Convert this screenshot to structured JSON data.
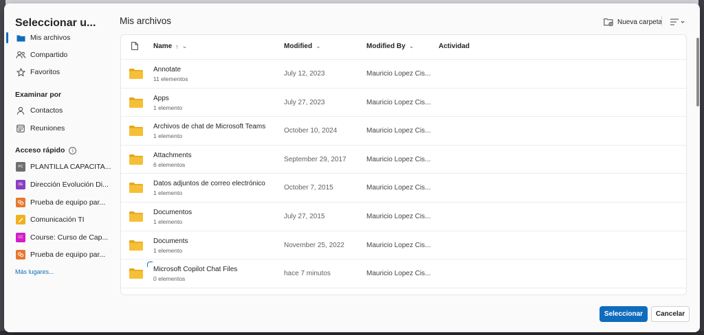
{
  "dialog": {
    "title": "Seleccionar u...",
    "main_title": "Mis archivos"
  },
  "sidebar": {
    "nav": [
      {
        "label": "Mis archivos",
        "icon": "folder-icon",
        "active": true
      },
      {
        "label": "Compartido",
        "icon": "people-icon",
        "active": false
      },
      {
        "label": "Favoritos",
        "icon": "star-icon",
        "active": false
      }
    ],
    "browse_heading": "Examinar por",
    "browse": [
      {
        "label": "Contactos",
        "icon": "person-icon"
      },
      {
        "label": "Reuniones",
        "icon": "calendar-icon"
      }
    ],
    "quick_heading": "Acceso rápido",
    "quick_info_icon": "info-icon",
    "quick": [
      {
        "label": "PLANTILLA CAPACITA...",
        "badge": "PC",
        "color": "#6e6e6e"
      },
      {
        "label": "Dirección Evolución Di...",
        "badge": "DE",
        "color": "#8a3fc2"
      },
      {
        "label": "Prueba de equipo par...",
        "badge": "",
        "color": "#e8772e"
      },
      {
        "label": "Comunicación TI",
        "badge": "",
        "color": "#f2b01e"
      },
      {
        "label": "Course: Curso de Cap...",
        "badge": "CC",
        "color": "#d21ec9"
      },
      {
        "label": "Prueba de equipo par...",
        "badge": "",
        "color": "#e8772e"
      }
    ],
    "more_link": "Más lugares..."
  },
  "toolbar": {
    "new_folder_label": "Nueva carpeta",
    "new_folder_icon": "new-folder-icon",
    "view_icon": "view-options-icon"
  },
  "table": {
    "file_type_icon": "file-icon",
    "columns": {
      "name": "Name",
      "modified": "Modified",
      "modified_by": "Modified By",
      "activity": "Actividad"
    },
    "rows": [
      {
        "name": "Annotate",
        "count": "11 elementos",
        "modified": "July 12, 2023",
        "by": "Mauricio Lopez Cis..."
      },
      {
        "name": "Apps",
        "count": "1 elemento",
        "modified": "July 27, 2023",
        "by": "Mauricio Lopez Cis..."
      },
      {
        "name": "Archivos de chat de Microsoft Teams",
        "count": "1 elemento",
        "modified": "October 10, 2024",
        "by": "Mauricio Lopez Cis..."
      },
      {
        "name": "Attachments",
        "count": "6 elementos",
        "modified": "September 29, 2017",
        "by": "Mauricio Lopez Cis..."
      },
      {
        "name": "Datos adjuntos de correo electrónico",
        "count": "1 elemento",
        "modified": "October 7, 2015",
        "by": "Mauricio Lopez Cis..."
      },
      {
        "name": "Documentos",
        "count": "1 elemento",
        "modified": "July 27, 2015",
        "by": "Mauricio Lopez Cis..."
      },
      {
        "name": "Documents",
        "count": "1 elemento",
        "modified": "November 25, 2022",
        "by": "Mauricio Lopez Cis..."
      },
      {
        "name": "Microsoft Copilot Chat Files",
        "count": "0 elementos",
        "modified": "hace 7 minutos",
        "by": "Mauricio Lopez Cis..."
      }
    ]
  },
  "footer": {
    "select_label": "Seleccionar",
    "cancel_label": "Cancelar"
  },
  "colors": {
    "accent": "#0f6cbd",
    "folder": "#f5c037"
  }
}
